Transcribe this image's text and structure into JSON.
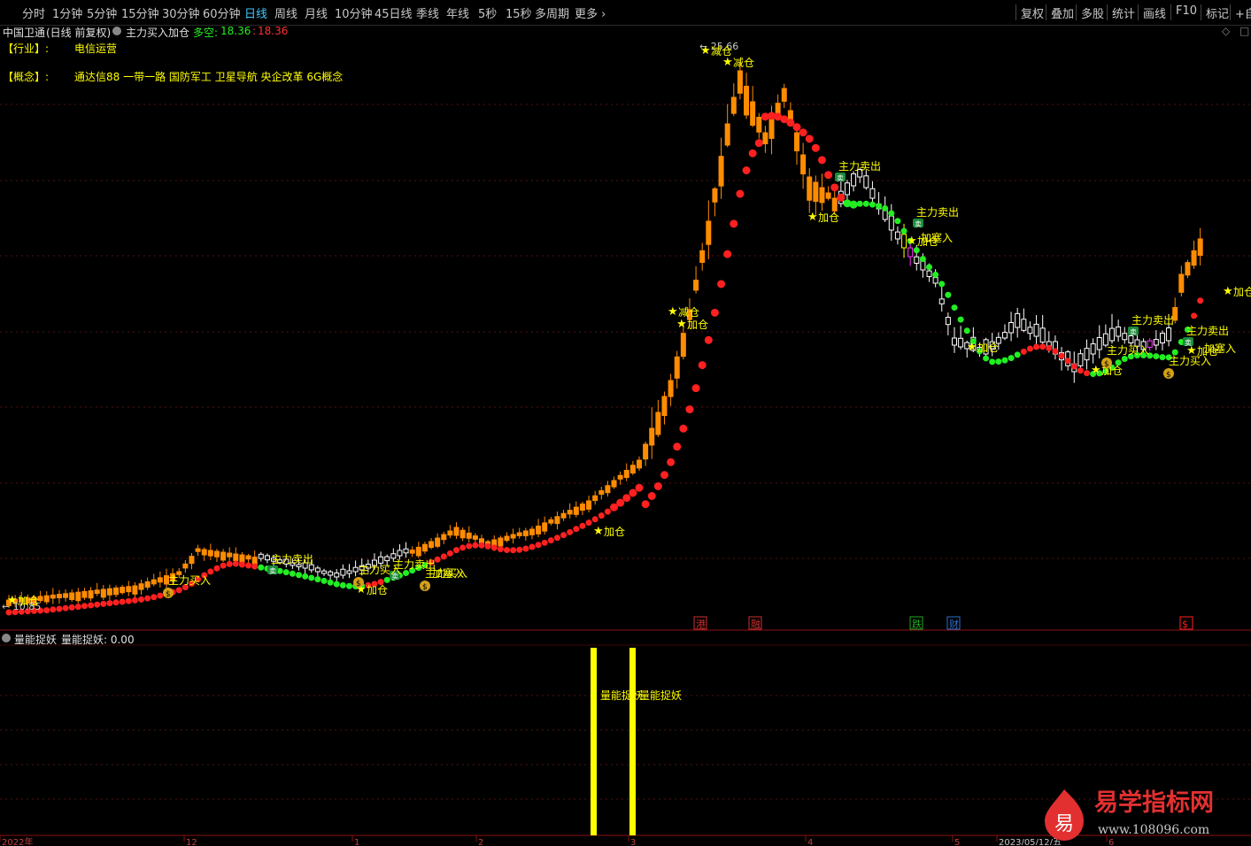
{
  "toolbar": {
    "periods": [
      "分时",
      "1分钟",
      "5分钟",
      "15分钟",
      "30分钟",
      "60分钟",
      "日线",
      "周线",
      "月线",
      "10分钟",
      "45日线",
      "季线",
      "年线",
      "5秒",
      "15秒",
      "多周期",
      "更多"
    ],
    "active": "日线",
    "right": [
      "复权",
      "叠加",
      "多股",
      "统计",
      "画线",
      "F10",
      "标记",
      "+自"
    ]
  },
  "header": {
    "stock": "中国卫通",
    "mode": "(日线 前复权)",
    "indicator": "主力买入加仓",
    "duokong_label": "多空:",
    "duokong_1": "18.36",
    "duokong_2": "18.36"
  },
  "info": {
    "industry_label": "【行业】:",
    "industry_value": "电信运营",
    "concept_label": "【概念】:",
    "concept_value": "通达信88 一带一路 国防军工 卫星导航 央企改革 6G概念"
  },
  "price_labels": {
    "high": "25.66",
    "low": "10.85"
  },
  "event_markers": [
    "港",
    "融",
    "跌",
    "财",
    "$"
  ],
  "signals": {
    "jiacang": "加仓",
    "jiancang": "减仓",
    "buy": "主力买入",
    "sell": "主力卖出",
    "add": "加仓",
    "jiasairu": "加塞入",
    "icon_sell": "卖",
    "icon_buy": "$"
  },
  "sub": {
    "name": "量能捉妖",
    "value_label": "量能捉妖: 0.00",
    "bar_label": "量能捉妖"
  },
  "date_labels": [
    "2022年",
    "12",
    "1",
    "2",
    "3",
    "4",
    "5",
    "2023/05/12/五",
    "6"
  ],
  "logo": {
    "text": "易学指标网",
    "url": "www.108096.com",
    "char": "易"
  },
  "colors": {
    "up": "#ff8c00",
    "down": "#ffffff",
    "red_dot": "#ff2020",
    "green_dot": "#22ee22",
    "yellow": "#ffff00",
    "magenta": "#ff33ff",
    "accent": "#3ec8ff"
  }
}
